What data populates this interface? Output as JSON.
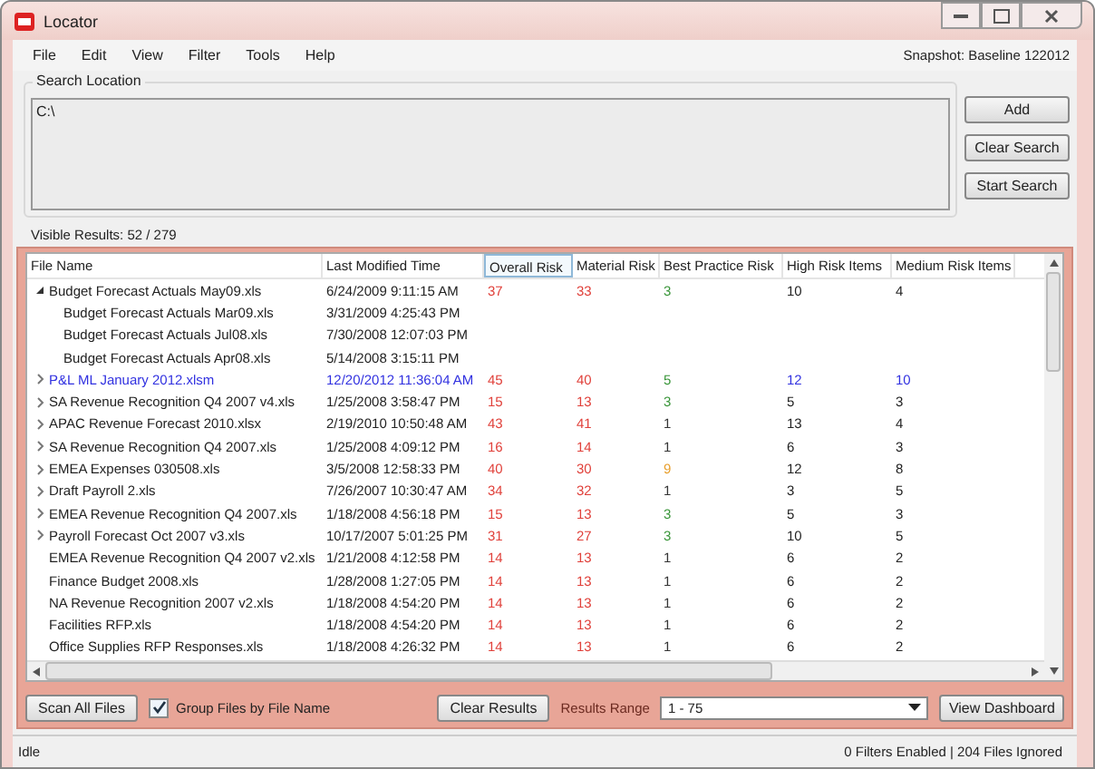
{
  "window": {
    "title": "Locator"
  },
  "menu": [
    {
      "label": "File"
    },
    {
      "label": "Edit"
    },
    {
      "label": "View"
    },
    {
      "label": "Filter"
    },
    {
      "label": "Tools"
    },
    {
      "label": "Help"
    }
  ],
  "snapshot": "Snapshot: Baseline 122012",
  "search": {
    "label": "Search Location",
    "value": "C:\\",
    "buttons": [
      "Add",
      "Clear Search",
      "Start Search"
    ]
  },
  "visible_results": "Visible Results: 52 / 279",
  "table": {
    "columns": [
      {
        "label": "File Name",
        "sorted": false
      },
      {
        "label": "Last Modified Time",
        "sorted": false
      },
      {
        "label": "Overall Risk",
        "sorted": true
      },
      {
        "label": "Material Risk",
        "sorted": false
      },
      {
        "label": "Best Practice Risk",
        "sorted": false
      },
      {
        "label": "High Risk Items",
        "sorted": false
      },
      {
        "label": "Medium Risk Items",
        "sorted": false
      }
    ],
    "rows": [
      {
        "kind": "group",
        "expanded": true,
        "selected": false,
        "name": "Budget Forecast Actuals May09.xls",
        "time": "6/24/2009 9:11:15 AM",
        "overall": "37",
        "material": "33",
        "best": {
          "value": "3",
          "color": "#3a963a"
        },
        "high": "10",
        "medium": "4",
        "children": [
          {
            "name": "Budget Forecast Actuals Mar09.xls",
            "time": "3/31/2009 4:25:43 PM"
          },
          {
            "name": "Budget Forecast Actuals Jul08.xls",
            "time": "7/30/2008 12:07:03 PM"
          },
          {
            "name": "Budget Forecast Actuals Apr08.xls",
            "time": "5/14/2008 3:15:11 PM"
          }
        ]
      },
      {
        "kind": "group",
        "expanded": false,
        "selected": true,
        "name": "P&L ML January 2012.xlsm",
        "time": "12/20/2012 11:36:04 AM",
        "overall": "45",
        "material": "40",
        "best": {
          "value": "5",
          "color": "#3a963a"
        },
        "high": "12",
        "medium": "10"
      },
      {
        "kind": "group",
        "expanded": false,
        "selected": false,
        "name": "SA Revenue Recognition Q4 2007 v4.xls",
        "time": "1/25/2008 3:58:47 PM",
        "overall": "15",
        "material": "13",
        "best": {
          "value": "3",
          "color": "#3a963a"
        },
        "high": "5",
        "medium": "3"
      },
      {
        "kind": "group",
        "expanded": false,
        "selected": false,
        "name": "APAC Revenue Forecast 2010.xlsx",
        "time": "2/19/2010 10:50:48 AM",
        "overall": "43",
        "material": "41",
        "best": {
          "value": "1",
          "color": "#333333"
        },
        "high": "13",
        "medium": "4"
      },
      {
        "kind": "group",
        "expanded": false,
        "selected": false,
        "name": "SA Revenue Recognition Q4 2007.xls",
        "time": "1/25/2008 4:09:12 PM",
        "overall": "16",
        "material": "14",
        "best": {
          "value": "1",
          "color": "#333333"
        },
        "high": "6",
        "medium": "3"
      },
      {
        "kind": "group",
        "expanded": false,
        "selected": false,
        "name": "EMEA Expenses 030508.xls",
        "time": "3/5/2008 12:58:33 PM",
        "overall": "40",
        "material": "30",
        "best": {
          "value": "9",
          "color": "#e8a030"
        },
        "high": "12",
        "medium": "8"
      },
      {
        "kind": "group",
        "expanded": false,
        "selected": false,
        "name": "Draft Payroll 2.xls",
        "time": "7/26/2007 10:30:47 AM",
        "overall": "34",
        "material": "32",
        "best": {
          "value": "1",
          "color": "#333333"
        },
        "high": "3",
        "medium": "5"
      },
      {
        "kind": "group",
        "expanded": false,
        "selected": false,
        "name": "EMEA Revenue Recognition Q4 2007.xls",
        "time": "1/18/2008 4:56:18 PM",
        "overall": "15",
        "material": "13",
        "best": {
          "value": "3",
          "color": "#3a963a"
        },
        "high": "5",
        "medium": "3"
      },
      {
        "kind": "group",
        "expanded": false,
        "selected": false,
        "name": "Payroll Forecast Oct 2007 v3.xls",
        "time": "10/17/2007 5:01:25 PM",
        "overall": "31",
        "material": "27",
        "best": {
          "value": "3",
          "color": "#3a963a"
        },
        "high": "10",
        "medium": "5"
      },
      {
        "kind": "file",
        "selected": false,
        "name": "EMEA Revenue Recognition Q4 2007 v2.xls",
        "time": "1/21/2008 4:12:58 PM",
        "overall": "14",
        "material": "13",
        "best": {
          "value": "1",
          "color": "#333333"
        },
        "high": "6",
        "medium": "2"
      },
      {
        "kind": "file",
        "selected": false,
        "name": "Finance Budget 2008.xls",
        "time": "1/28/2008 1:27:05 PM",
        "overall": "14",
        "material": "13",
        "best": {
          "value": "1",
          "color": "#333333"
        },
        "high": "6",
        "medium": "2"
      },
      {
        "kind": "file",
        "selected": false,
        "name": "NA Revenue Recognition 2007 v2.xls",
        "time": "1/18/2008 4:54:20 PM",
        "overall": "14",
        "material": "13",
        "best": {
          "value": "1",
          "color": "#333333"
        },
        "high": "6",
        "medium": "2"
      },
      {
        "kind": "file",
        "selected": false,
        "name": "Facilities RFP.xls",
        "time": "1/18/2008 4:54:20 PM",
        "overall": "14",
        "material": "13",
        "best": {
          "value": "1",
          "color": "#333333"
        },
        "high": "6",
        "medium": "2"
      },
      {
        "kind": "file",
        "selected": false,
        "name": "Office Supplies RFP Responses.xls",
        "time": "1/18/2008 4:26:32 PM",
        "overall": "14",
        "material": "13",
        "best": {
          "value": "1",
          "color": "#333333"
        },
        "high": "6",
        "medium": "2"
      }
    ]
  },
  "bottom": {
    "scan_button": "Scan All Files",
    "group_checkbox": {
      "label": "Group Files by File Name",
      "checked": true
    },
    "clear_button": "Clear Results",
    "range_label": "Results Range",
    "range_value": "1 - 75",
    "dashboard_button": "View Dashboard"
  },
  "status_bar": {
    "left": "Idle",
    "right": "0 Filters Enabled | 204 Files Ignored"
  }
}
